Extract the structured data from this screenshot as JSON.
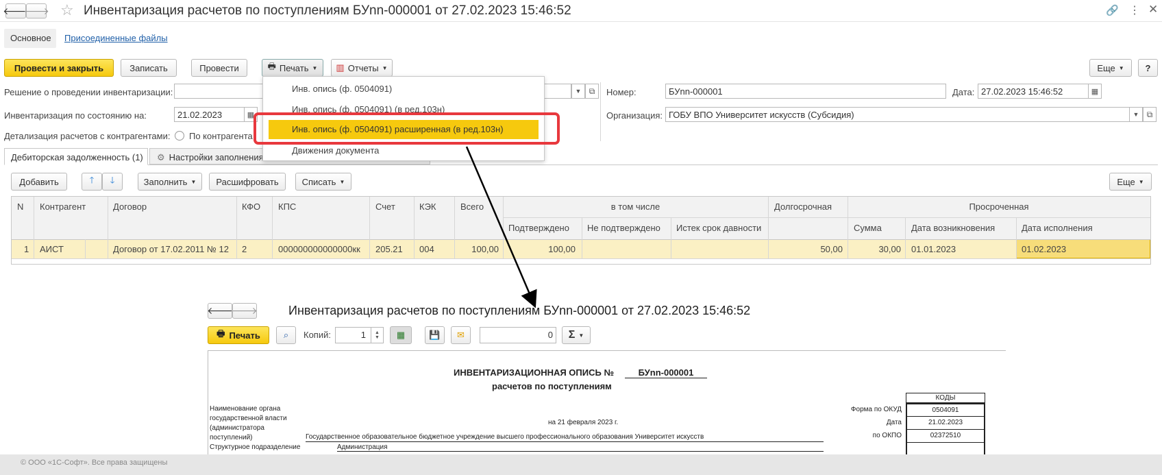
{
  "window": {
    "title": "Инвентаризация расчетов по поступлениям БУnn-000001 от 27.02.2023 15:46:52",
    "tabs": [
      "Основное",
      "Присоединенные файлы"
    ]
  },
  "toolbar": {
    "post_close": "Провести и закрыть",
    "save": "Записать",
    "post": "Провести",
    "print": "Печать",
    "reports": "Отчеты",
    "more": "Еще",
    "help": "?"
  },
  "print_menu": {
    "items": [
      "Инв. опись (ф. 0504091)",
      "Инв. опись (ф. 0504091) (в ред.103н)",
      "Инв. опись (ф. 0504091) расширенная (в ред.103н)",
      "Движения документа"
    ]
  },
  "form": {
    "decision_label": "Решение о проведении инвентаризации:",
    "decision_value": "",
    "state_label": "Инвентаризация по состоянию на:",
    "state_value": "21.02.2023",
    "detail_label": "Детализация расчетов с контрагентами:",
    "detail_option": "По контрагента",
    "number_label": "Номер:",
    "number_value": "БУnn-000001",
    "date_label": "Дата:",
    "date_value": "27.02.2023 15:46:52",
    "org_label": "Организация:",
    "org_value": "ГОБУ ВПО Университет искусств (Субсидия)"
  },
  "subtabs": [
    "Дебиторская задолженность (1)",
    "Настройки заполнения"
  ],
  "table_toolbar": {
    "add": "Добавить",
    "fill": "Заполнить",
    "decode": "Расшифровать",
    "writeoff": "Списать",
    "more": "Еще"
  },
  "table": {
    "headers": {
      "n": "N",
      "counterparty": "Контрагент",
      "contract": "Договор",
      "kfo": "КФО",
      "kps": "КПС",
      "account": "Счет",
      "kek": "КЭК",
      "total": "Всего",
      "including": "в том числе",
      "confirmed": "Подтверждено",
      "not_confirmed": "Не подтверждено",
      "expired": "Истек срок давности",
      "longterm": "Долгосрочная",
      "overdue": "Просроченная",
      "sum": "Сумма",
      "date_origin": "Дата возникновения",
      "date_exec": "Дата исполнения"
    },
    "row": {
      "n": "1",
      "counterparty": "АИСТ",
      "contract": "Договор от 17.02.2011 № 12",
      "kfo": "2",
      "kps": "000000000000000кк",
      "account": "205.21",
      "kek": "004",
      "total": "100,00",
      "confirmed": "100,00",
      "not_confirmed": "",
      "expired": "",
      "longterm": "50,00",
      "sum": "30,00",
      "date_origin": "01.01.2023",
      "date_exec": "01.02.2023"
    }
  },
  "print_window": {
    "title": "Инвентаризация расчетов по поступлениям БУnn-000001 от 27.02.2023 15:46:52",
    "print_btn": "Печать",
    "copies_label": "Копий:",
    "copies_value": "1",
    "sum_value": "0",
    "sigma": "Σ"
  },
  "doc": {
    "title_prefix": "ИНВЕНТАРИЗАЦИОННАЯ ОПИСЬ №",
    "title_number": "БУnn-000001",
    "subtitle": "расчетов по поступлениям",
    "codes_header": "КОДЫ",
    "okud_label": "Форма по ОКУД",
    "okud_value": "0504091",
    "date_label": "Дата",
    "date_value": "21.02.2023",
    "okpo_label": "по ОКПО",
    "okpo_value": "02372510",
    "org_body_label": "Наименование органа государственной власти (администратора поступлений)",
    "on_date": "на 21 февраля 2023 г.",
    "org_full": "Государственное образовательное бюджетное учреждение высшего профессионального образования  Университет искусств",
    "struct_label": "Структурное подразделение",
    "struct_value": "Администрация"
  },
  "footer": "© ООО «1С-Софт». Все права защищены",
  "colors": {
    "accent_yellow": "#f6c90e",
    "highlight_red": "#e8383d",
    "row_selected": "#fbf0c4",
    "link_blue": "#1f5fa8"
  }
}
